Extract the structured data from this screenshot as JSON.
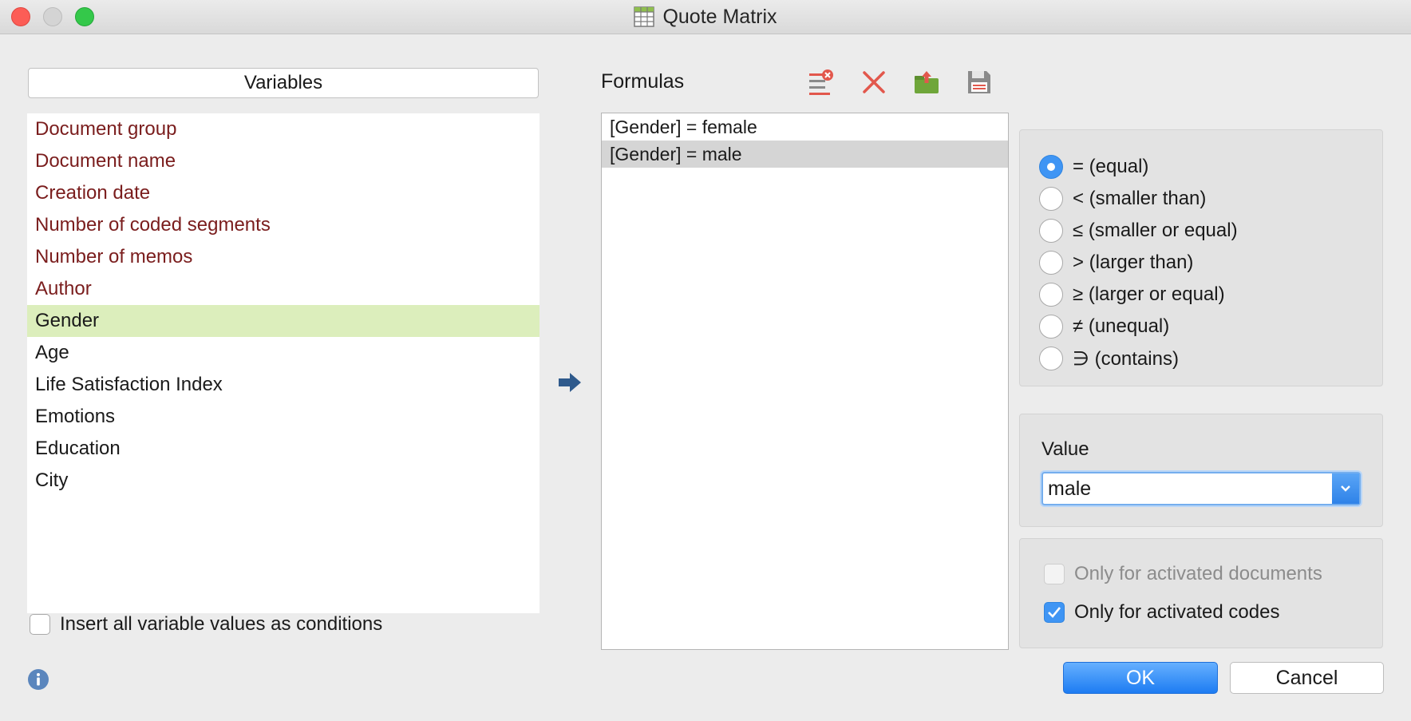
{
  "window": {
    "title": "Quote Matrix"
  },
  "variables": {
    "header": "Variables",
    "items": [
      {
        "label": "Document group",
        "kind": "system"
      },
      {
        "label": "Document name",
        "kind": "system"
      },
      {
        "label": "Creation date",
        "kind": "system"
      },
      {
        "label": "Number of coded segments",
        "kind": "system"
      },
      {
        "label": "Number of memos",
        "kind": "system"
      },
      {
        "label": "Author",
        "kind": "system"
      },
      {
        "label": "Gender",
        "kind": "user",
        "selected": true
      },
      {
        "label": "Age",
        "kind": "user"
      },
      {
        "label": "Life Satisfaction Index",
        "kind": "user"
      },
      {
        "label": "Emotions",
        "kind": "user"
      },
      {
        "label": "Education",
        "kind": "user"
      },
      {
        "label": "City",
        "kind": "user"
      }
    ],
    "insert_all_label": "Insert all variable values as conditions",
    "insert_all_checked": false
  },
  "formulas": {
    "label": "Formulas",
    "toolbar": [
      "delete-all-icon",
      "delete-icon",
      "open-icon",
      "save-icon"
    ],
    "items": [
      {
        "text": "[Gender] = female",
        "selected": false
      },
      {
        "text": "[Gender] = male",
        "selected": true
      }
    ]
  },
  "operators": [
    {
      "label": "= (equal)",
      "checked": true
    },
    {
      "label": "< (smaller than)",
      "checked": false
    },
    {
      "label": "≤ (smaller or equal)",
      "checked": false
    },
    {
      "label": "> (larger than)",
      "checked": false
    },
    {
      "label": "≥ (larger or equal)",
      "checked": false
    },
    {
      "label": "≠ (unequal)",
      "checked": false
    },
    {
      "label": "∋ (contains)",
      "checked": false
    }
  ],
  "value": {
    "label": "Value",
    "selected": "male"
  },
  "options": {
    "activated_documents": {
      "label": "Only for activated documents",
      "checked": false,
      "disabled": true
    },
    "activated_codes": {
      "label": "Only for activated codes",
      "checked": true,
      "disabled": false
    }
  },
  "buttons": {
    "ok": "OK",
    "cancel": "Cancel"
  },
  "colors": {
    "accent": "#3f95f4",
    "system_variable": "#7a1d1d",
    "selection_green": "#dceebc",
    "delete_red": "#e2574c",
    "open_green": "#6fa63a"
  }
}
